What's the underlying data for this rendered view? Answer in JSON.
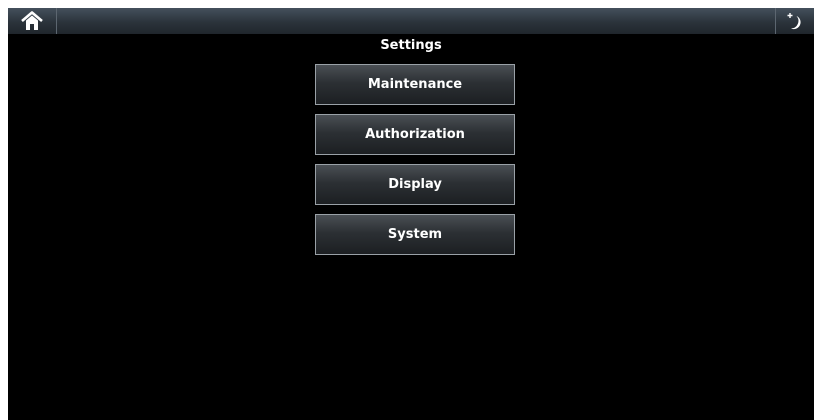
{
  "header": {
    "home_icon": "home-icon",
    "night_mode_icon": "moon-star-icon"
  },
  "page": {
    "title": "Settings"
  },
  "menu": {
    "items": [
      {
        "label": "Maintenance"
      },
      {
        "label": "Authorization"
      },
      {
        "label": "Display"
      },
      {
        "label": "System"
      }
    ]
  },
  "colors": {
    "background": "#000000",
    "topbar": "#2b333b",
    "button_border": "#9aa1a7",
    "text": "#ffffff"
  }
}
